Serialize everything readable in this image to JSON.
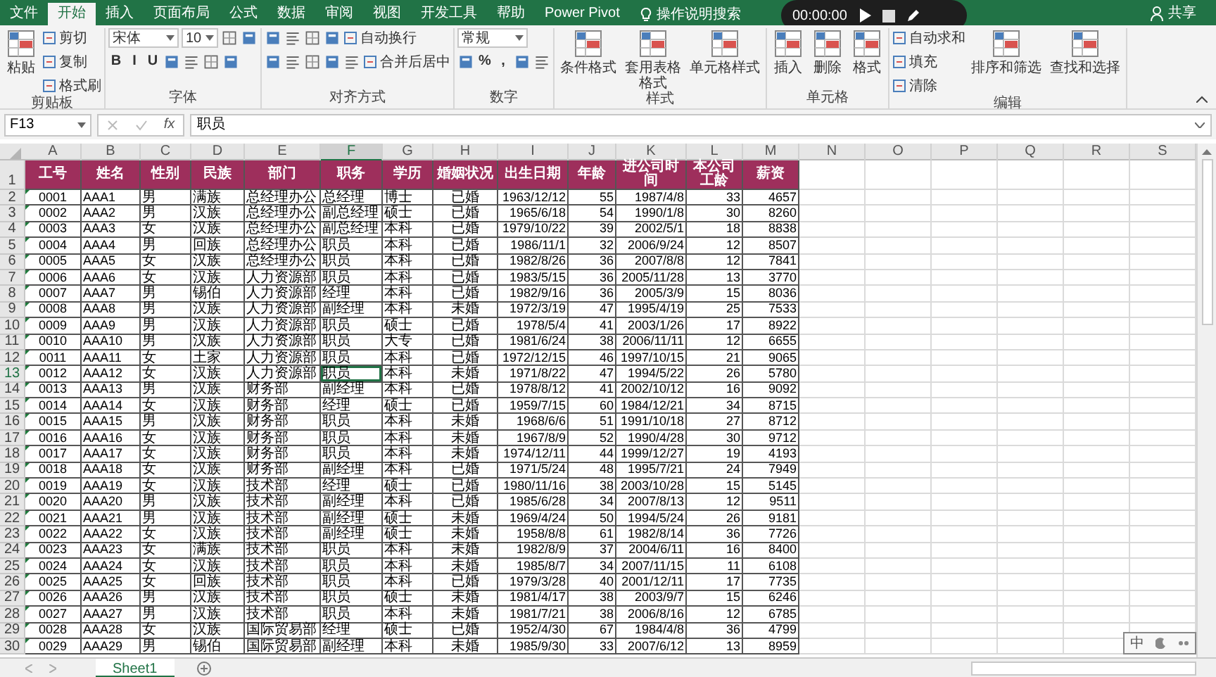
{
  "ribbon_tabs": [
    {
      "label": "文件",
      "selected": false
    },
    {
      "label": "开始",
      "selected": true
    },
    {
      "label": "插入",
      "selected": false
    },
    {
      "label": "页面布局",
      "selected": false
    },
    {
      "label": "公式",
      "selected": false
    },
    {
      "label": "数据",
      "selected": false
    },
    {
      "label": "审阅",
      "selected": false
    },
    {
      "label": "视图",
      "selected": false
    },
    {
      "label": "开发工具",
      "selected": false
    },
    {
      "label": "帮助",
      "selected": false
    },
    {
      "label": "Power Pivot",
      "selected": false
    }
  ],
  "tell_me": {
    "label": "操作说明搜索"
  },
  "share": {
    "label": "共享"
  },
  "recorder": {
    "time": "00:00:00"
  },
  "ribbon_groups": [
    {
      "name": "剪贴板",
      "columns": [
        {
          "kind": "large",
          "label": "粘贴"
        },
        {
          "kind": "stack",
          "lines": [
            [
              {
                "kind": "small",
                "label": "剪切"
              }
            ],
            [
              {
                "kind": "small",
                "label": "复制"
              }
            ],
            [
              {
                "kind": "small",
                "label": "格式刷"
              }
            ]
          ]
        }
      ]
    },
    {
      "name": "字体",
      "columns": [
        {
          "kind": "stack",
          "lines": [
            [
              {
                "kind": "field",
                "value": "宋体"
              },
              {
                "kind": "field",
                "value": "10"
              },
              {
                "kind": "icon"
              },
              {
                "kind": "icon"
              }
            ],
            [
              {
                "kind": "glyph",
                "label": "B"
              },
              {
                "kind": "glyph",
                "label": "I"
              },
              {
                "kind": "glyph",
                "label": "U"
              },
              {
                "kind": "icon"
              },
              {
                "kind": "icon"
              },
              {
                "kind": "icon"
              },
              {
                "kind": "icon"
              }
            ]
          ]
        }
      ]
    },
    {
      "name": "对齐方式",
      "columns": [
        {
          "kind": "stack",
          "lines": [
            [
              {
                "kind": "icon"
              },
              {
                "kind": "icon"
              },
              {
                "kind": "icon"
              },
              {
                "kind": "icon"
              },
              {
                "kind": "small",
                "label": "自动换行"
              }
            ],
            [
              {
                "kind": "icon"
              },
              {
                "kind": "icon"
              },
              {
                "kind": "icon"
              },
              {
                "kind": "icon"
              },
              {
                "kind": "icon"
              },
              {
                "kind": "small",
                "label": "合并后居中"
              }
            ]
          ]
        }
      ]
    },
    {
      "name": "数字",
      "columns": [
        {
          "kind": "stack",
          "lines": [
            [
              {
                "kind": "field",
                "value": "常规"
              }
            ],
            [
              {
                "kind": "icon"
              },
              {
                "kind": "glyph",
                "label": "%"
              },
              {
                "kind": "glyph",
                "label": ","
              },
              {
                "kind": "icon"
              },
              {
                "kind": "icon"
              }
            ]
          ]
        }
      ]
    },
    {
      "name": "样式",
      "columns": [
        {
          "kind": "large",
          "label": "条件格式"
        },
        {
          "kind": "large",
          "label": "套用表格格式"
        },
        {
          "kind": "large",
          "label": "单元格样式"
        }
      ]
    },
    {
      "name": "单元格",
      "columns": [
        {
          "kind": "large",
          "label": "插入"
        },
        {
          "kind": "large",
          "label": "删除"
        },
        {
          "kind": "large",
          "label": "格式"
        }
      ]
    },
    {
      "name": "编辑",
      "columns": [
        {
          "kind": "stack",
          "lines": [
            [
              {
                "kind": "small",
                "label": "自动求和"
              }
            ],
            [
              {
                "kind": "small",
                "label": "填充"
              }
            ],
            [
              {
                "kind": "small",
                "label": "清除"
              }
            ]
          ]
        },
        {
          "kind": "large",
          "label": "排序和筛选"
        },
        {
          "kind": "large",
          "label": "查找和选择"
        }
      ]
    }
  ],
  "formula_bar": {
    "name_box": "F13",
    "function_label": "fx",
    "value": "职员"
  },
  "columns": [
    {
      "letter": "A",
      "selected": false
    },
    {
      "letter": "B",
      "selected": false
    },
    {
      "letter": "C",
      "selected": false
    },
    {
      "letter": "D",
      "selected": false
    },
    {
      "letter": "E",
      "selected": false
    },
    {
      "letter": "F",
      "selected": true
    },
    {
      "letter": "G",
      "selected": false
    },
    {
      "letter": "H",
      "selected": false
    },
    {
      "letter": "I",
      "selected": false
    },
    {
      "letter": "J",
      "selected": false
    },
    {
      "letter": "K",
      "selected": false
    },
    {
      "letter": "L",
      "selected": false
    },
    {
      "letter": "M",
      "selected": false
    },
    {
      "letter": "N",
      "selected": false
    },
    {
      "letter": "O",
      "selected": false
    },
    {
      "letter": "P",
      "selected": false
    },
    {
      "letter": "Q",
      "selected": false
    },
    {
      "letter": "R",
      "selected": false
    },
    {
      "letter": "S",
      "selected": false
    }
  ],
  "header_row": {
    "number": "1",
    "cells": [
      "工号",
      "姓名",
      "性别",
      "民族",
      "部门",
      "职务",
      "学历",
      "婚姻状况",
      "出生日期",
      "年龄",
      "进公司时间",
      "本公司工龄",
      "薪资"
    ]
  },
  "rows": [
    {
      "number": "2",
      "selected": false,
      "cells": [
        "0001",
        "AAA1",
        "男",
        "满族",
        "总经理办公",
        "总经理",
        "博士",
        "已婚",
        "1963/12/12",
        "55",
        "1987/4/8",
        "33",
        "4657"
      ]
    },
    {
      "number": "3",
      "selected": false,
      "cells": [
        "0002",
        "AAA2",
        "男",
        "汉族",
        "总经理办公",
        "副总经理",
        "硕士",
        "已婚",
        "1965/6/18",
        "54",
        "1990/1/8",
        "30",
        "8260"
      ]
    },
    {
      "number": "4",
      "selected": false,
      "cells": [
        "0003",
        "AAA3",
        "女",
        "汉族",
        "总经理办公",
        "副总经理",
        "本科",
        "已婚",
        "1979/10/22",
        "39",
        "2002/5/1",
        "18",
        "8838"
      ]
    },
    {
      "number": "5",
      "selected": false,
      "cells": [
        "0004",
        "AAA4",
        "男",
        "回族",
        "总经理办公",
        "职员",
        "本科",
        "已婚",
        "1986/11/1",
        "32",
        "2006/9/24",
        "12",
        "8507"
      ]
    },
    {
      "number": "6",
      "selected": false,
      "cells": [
        "0005",
        "AAA5",
        "女",
        "汉族",
        "总经理办公",
        "职员",
        "本科",
        "已婚",
        "1982/8/26",
        "36",
        "2007/8/8",
        "12",
        "7841"
      ]
    },
    {
      "number": "7",
      "selected": false,
      "cells": [
        "0006",
        "AAA6",
        "女",
        "汉族",
        "人力资源部",
        "职员",
        "本科",
        "已婚",
        "1983/5/15",
        "36",
        "2005/11/28",
        "13",
        "3770"
      ]
    },
    {
      "number": "8",
      "selected": false,
      "cells": [
        "0007",
        "AAA7",
        "男",
        "锡伯",
        "人力资源部",
        "经理",
        "本科",
        "已婚",
        "1982/9/16",
        "36",
        "2005/3/9",
        "15",
        "8036"
      ]
    },
    {
      "number": "9",
      "selected": false,
      "cells": [
        "0008",
        "AAA8",
        "男",
        "汉族",
        "人力资源部",
        "副经理",
        "本科",
        "未婚",
        "1972/3/19",
        "47",
        "1995/4/19",
        "25",
        "7533"
      ]
    },
    {
      "number": "10",
      "selected": false,
      "cells": [
        "0009",
        "AAA9",
        "男",
        "汉族",
        "人力资源部",
        "职员",
        "硕士",
        "已婚",
        "1978/5/4",
        "41",
        "2003/1/26",
        "17",
        "8922"
      ]
    },
    {
      "number": "11",
      "selected": false,
      "cells": [
        "0010",
        "AAA10",
        "男",
        "汉族",
        "人力资源部",
        "职员",
        "大专",
        "已婚",
        "1981/6/24",
        "38",
        "2006/11/11",
        "12",
        "6655"
      ]
    },
    {
      "number": "12",
      "selected": false,
      "cells": [
        "0011",
        "AAA11",
        "女",
        "土家",
        "人力资源部",
        "职员",
        "本科",
        "已婚",
        "1972/12/15",
        "46",
        "1997/10/15",
        "21",
        "9065"
      ]
    },
    {
      "number": "13",
      "selected": true,
      "cells": [
        "0012",
        "AAA12",
        "女",
        "汉族",
        "人力资源部",
        "职员",
        "本科",
        "未婚",
        "1971/8/22",
        "47",
        "1994/5/22",
        "26",
        "5780"
      ]
    },
    {
      "number": "14",
      "selected": false,
      "cells": [
        "0013",
        "AAA13",
        "男",
        "汉族",
        "财务部",
        "副经理",
        "本科",
        "已婚",
        "1978/8/12",
        "41",
        "2002/10/12",
        "16",
        "9092"
      ]
    },
    {
      "number": "15",
      "selected": false,
      "cells": [
        "0014",
        "AAA14",
        "女",
        "汉族",
        "财务部",
        "经理",
        "硕士",
        "已婚",
        "1959/7/15",
        "60",
        "1984/12/21",
        "34",
        "8715"
      ]
    },
    {
      "number": "16",
      "selected": false,
      "cells": [
        "0015",
        "AAA15",
        "男",
        "汉族",
        "财务部",
        "职员",
        "本科",
        "未婚",
        "1968/6/6",
        "51",
        "1991/10/18",
        "27",
        "8712"
      ]
    },
    {
      "number": "17",
      "selected": false,
      "cells": [
        "0016",
        "AAA16",
        "女",
        "汉族",
        "财务部",
        "职员",
        "本科",
        "未婚",
        "1967/8/9",
        "52",
        "1990/4/28",
        "30",
        "9712"
      ]
    },
    {
      "number": "18",
      "selected": false,
      "cells": [
        "0017",
        "AAA17",
        "女",
        "汉族",
        "财务部",
        "职员",
        "本科",
        "未婚",
        "1974/12/11",
        "44",
        "1999/12/27",
        "19",
        "4193"
      ]
    },
    {
      "number": "19",
      "selected": false,
      "cells": [
        "0018",
        "AAA18",
        "女",
        "汉族",
        "财务部",
        "副经理",
        "本科",
        "已婚",
        "1971/5/24",
        "48",
        "1995/7/21",
        "24",
        "7949"
      ]
    },
    {
      "number": "20",
      "selected": false,
      "cells": [
        "0019",
        "AAA19",
        "女",
        "汉族",
        "技术部",
        "经理",
        "硕士",
        "已婚",
        "1980/11/16",
        "38",
        "2003/10/28",
        "15",
        "5145"
      ]
    },
    {
      "number": "21",
      "selected": false,
      "cells": [
        "0020",
        "AAA20",
        "男",
        "汉族",
        "技术部",
        "副经理",
        "本科",
        "已婚",
        "1985/6/28",
        "34",
        "2007/8/13",
        "12",
        "9511"
      ]
    },
    {
      "number": "22",
      "selected": false,
      "cells": [
        "0021",
        "AAA21",
        "男",
        "汉族",
        "技术部",
        "副经理",
        "硕士",
        "未婚",
        "1969/4/24",
        "50",
        "1994/5/24",
        "26",
        "9181"
      ]
    },
    {
      "number": "23",
      "selected": false,
      "cells": [
        "0022",
        "AAA22",
        "女",
        "汉族",
        "技术部",
        "副经理",
        "硕士",
        "未婚",
        "1958/8/8",
        "61",
        "1982/8/14",
        "36",
        "7726"
      ]
    },
    {
      "number": "24",
      "selected": false,
      "cells": [
        "0023",
        "AAA23",
        "女",
        "满族",
        "技术部",
        "职员",
        "本科",
        "未婚",
        "1982/8/9",
        "37",
        "2004/6/11",
        "16",
        "8400"
      ]
    },
    {
      "number": "25",
      "selected": false,
      "cells": [
        "0024",
        "AAA24",
        "女",
        "汉族",
        "技术部",
        "职员",
        "本科",
        "未婚",
        "1985/8/7",
        "34",
        "2007/11/15",
        "11",
        "6108"
      ]
    },
    {
      "number": "26",
      "selected": false,
      "cells": [
        "0025",
        "AAA25",
        "女",
        "回族",
        "技术部",
        "职员",
        "本科",
        "已婚",
        "1979/3/28",
        "40",
        "2001/12/11",
        "17",
        "7735"
      ]
    },
    {
      "number": "27",
      "selected": false,
      "cells": [
        "0026",
        "AAA26",
        "男",
        "汉族",
        "技术部",
        "职员",
        "硕士",
        "未婚",
        "1981/4/17",
        "38",
        "2003/9/7",
        "15",
        "6246"
      ]
    },
    {
      "number": "28",
      "selected": false,
      "cells": [
        "0027",
        "AAA27",
        "男",
        "汉族",
        "技术部",
        "职员",
        "本科",
        "未婚",
        "1981/7/21",
        "38",
        "2006/8/16",
        "12",
        "6785"
      ]
    },
    {
      "number": "29",
      "selected": false,
      "cells": [
        "0028",
        "AAA28",
        "女",
        "汉族",
        "国际贸易部",
        "经理",
        "硕士",
        "已婚",
        "1952/4/30",
        "67",
        "1984/4/8",
        "36",
        "4799"
      ]
    },
    {
      "number": "30",
      "selected": false,
      "cells": [
        "0029",
        "AAA29",
        "男",
        "锡伯",
        "国际贸易部",
        "副经理",
        "本科",
        "未婚",
        "1985/9/30",
        "33",
        "2007/6/12",
        "13",
        "8959"
      ]
    }
  ],
  "sheet_tabs": [
    {
      "label": "Sheet1",
      "selected": true
    }
  ],
  "ime_bar": {
    "label": "中"
  }
}
